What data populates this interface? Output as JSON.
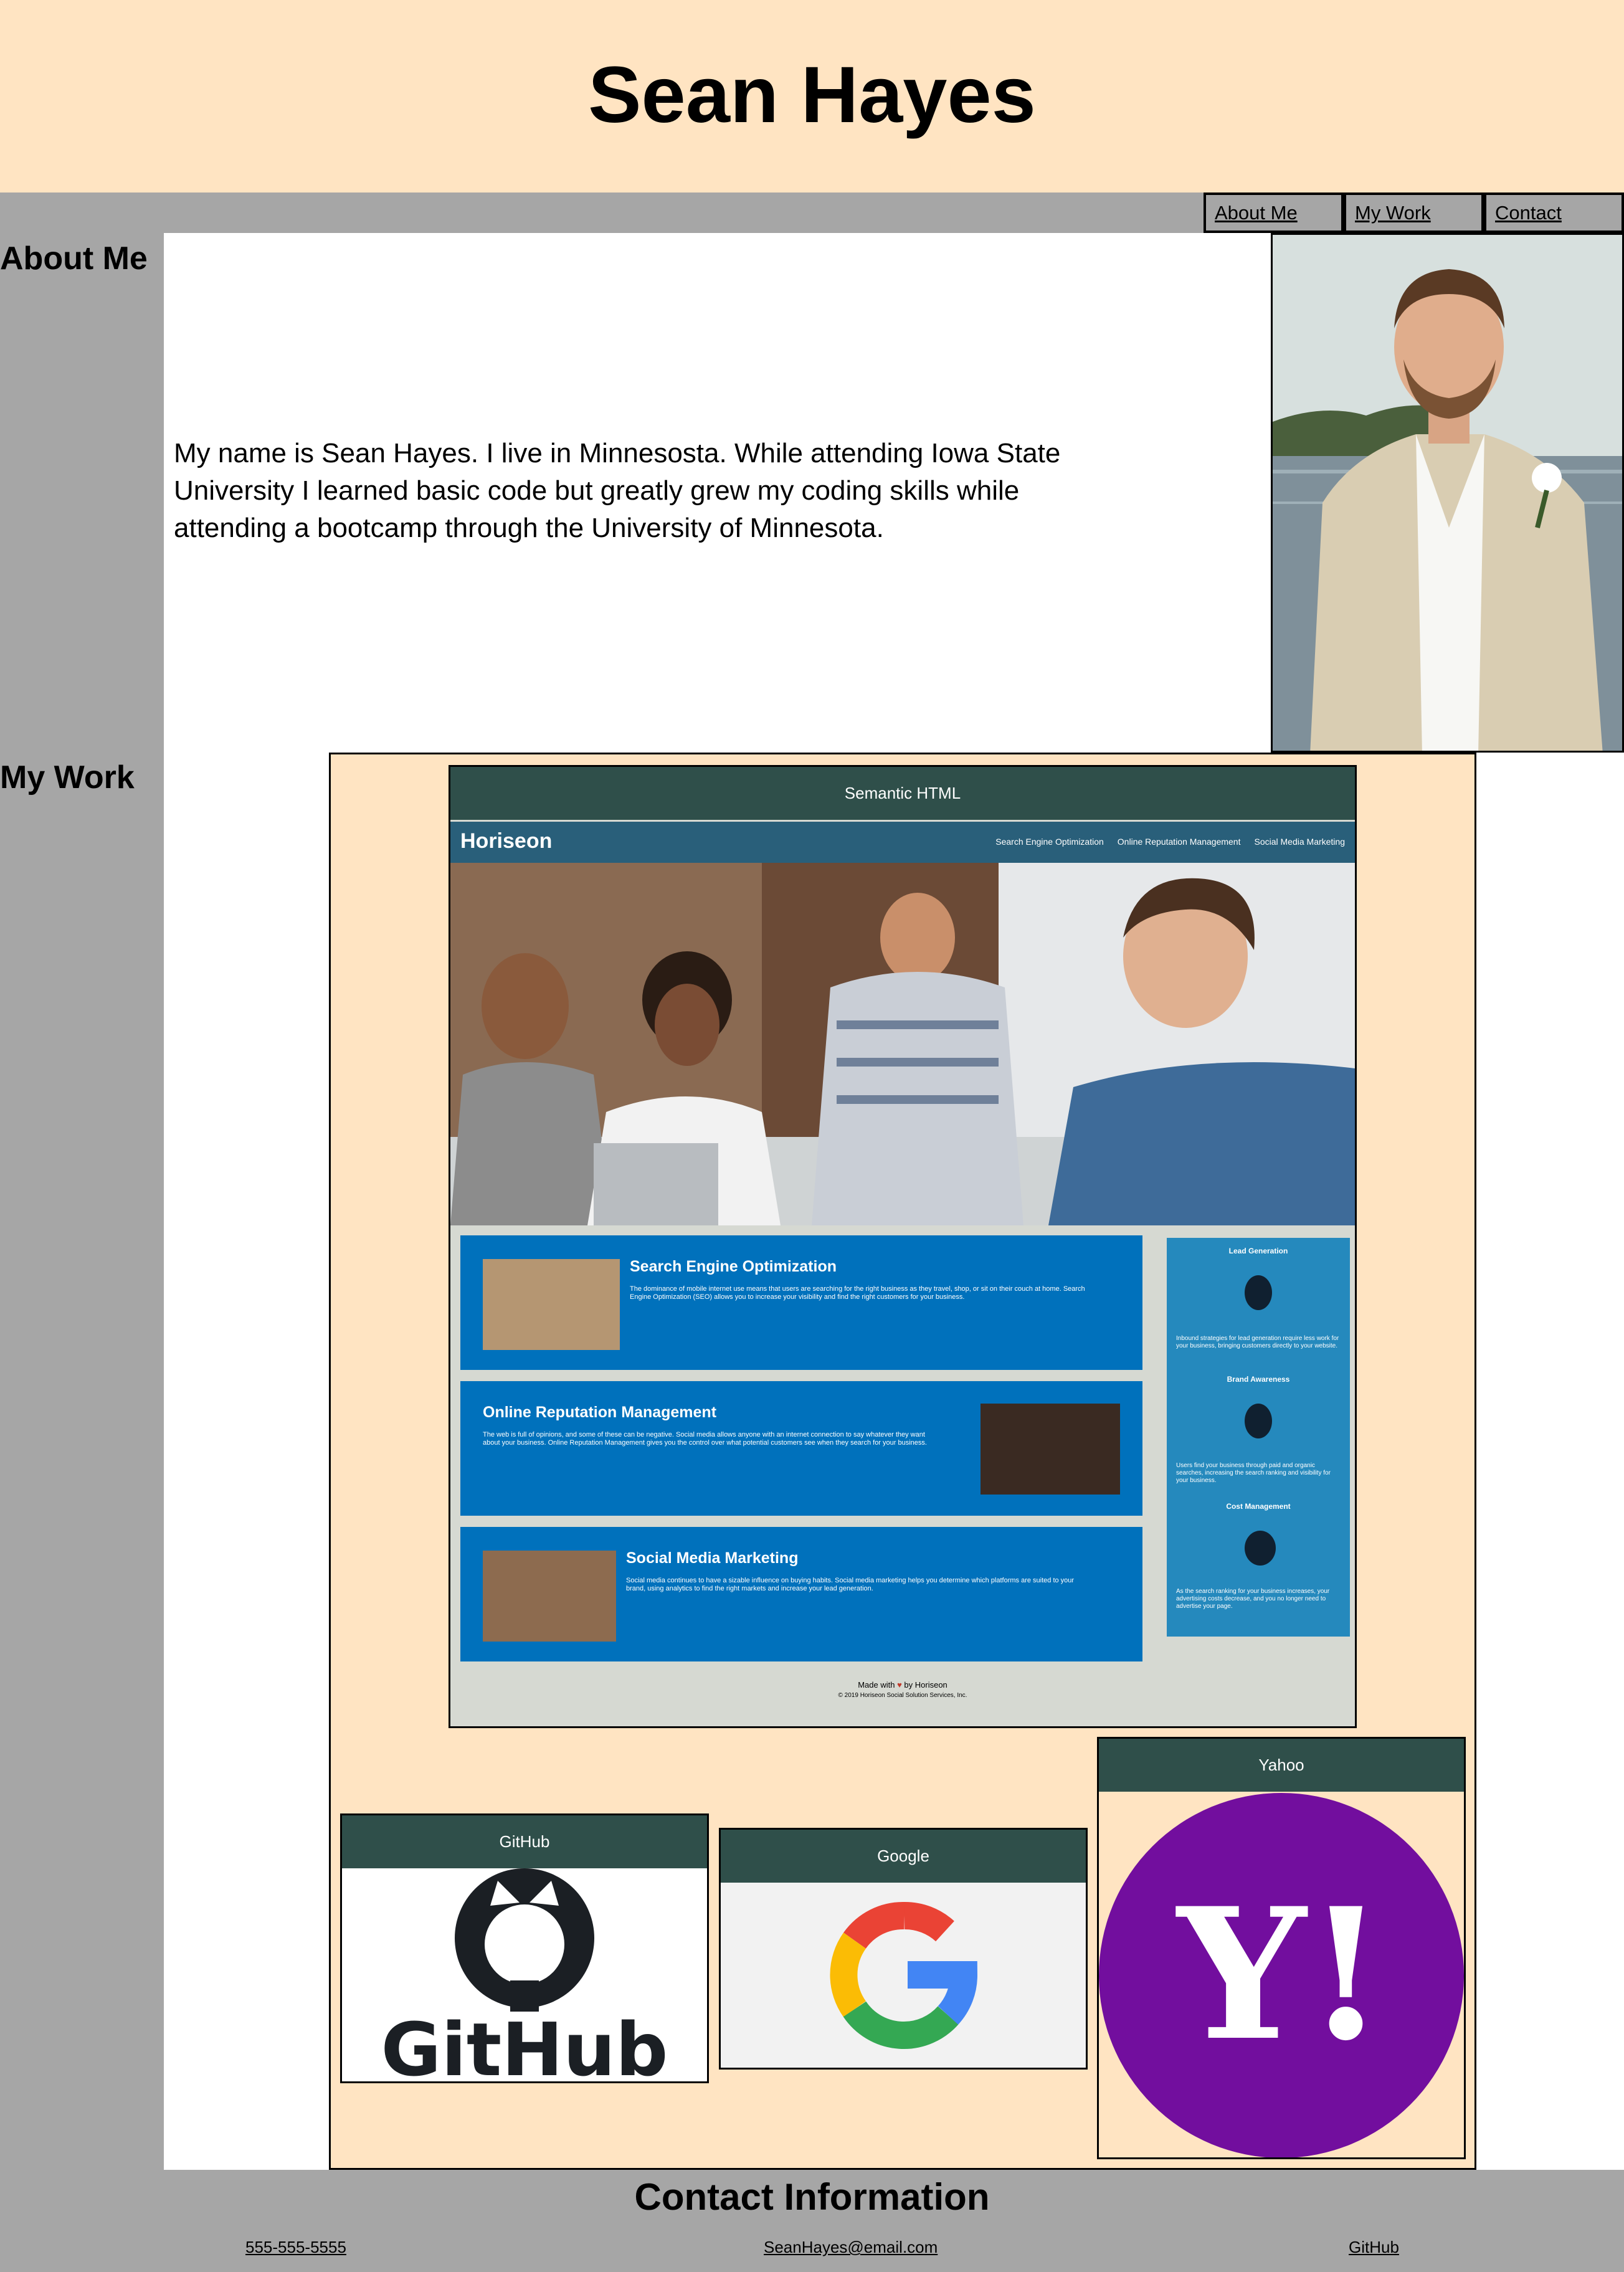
{
  "header": {
    "title": "Sean Hayes"
  },
  "nav": {
    "items": [
      "About Me",
      "My Work",
      "Contact"
    ]
  },
  "about": {
    "heading": "About Me",
    "text": "My name is Sean Hayes. I live in Minnesosta. While attending Iowa State University I learned basic code but greatly grew my coding skills while attending a bootcamp through the University of Minnesota."
  },
  "work": {
    "heading": "My Work",
    "featured": {
      "title": "Semantic HTML",
      "mock": {
        "logo": "Horiseon",
        "links": [
          "Search Engine Optimization",
          "Online Reputation Management",
          "Social Media Marketing"
        ],
        "sections": [
          {
            "title": "Search Engine Optimization",
            "text": "The dominance of mobile internet use means that users are searching for the right business as they travel, shop, or sit on their couch at home. Search Engine Optimization (SEO) allows you to increase your visibility and find the right customers for your business."
          },
          {
            "title": "Online Reputation Management",
            "text": "The web is full of opinions, and some of these can be negative. Social media allows anyone with an internet connection to say whatever they want about your business. Online Reputation Management gives you the control over what potential customers see when they search for your business."
          },
          {
            "title": "Social Media Marketing",
            "text": "Social media continues to have a sizable influence on buying habits. Social media marketing helps you determine which platforms are suited to your brand, using analytics to find the right markets and increase your lead generation."
          }
        ],
        "benefits": [
          {
            "title": "Lead Generation",
            "text": "Inbound strategies for lead generation require less work for your business, bringing customers directly to your website."
          },
          {
            "title": "Brand Awareness",
            "text": "Users find your business through paid and organic searches, increasing the search ranking and visibility for your business."
          },
          {
            "title": "Cost Management",
            "text": "As the search ranking for your business increases, your advertising costs decrease, and you no longer need to advertise your page."
          }
        ],
        "footer_made": "Made with",
        "footer_by": "by Horiseon",
        "footer_copy": "© 2019 Horiseon Social Solution Services, Inc."
      }
    },
    "cards": [
      {
        "title": "GitHub",
        "logo_text": "GitHub"
      },
      {
        "title": "Google"
      },
      {
        "title": "Yahoo",
        "logo_text": "Y!"
      }
    ]
  },
  "contact": {
    "heading": "Contact Information",
    "phone": "555-555-5555",
    "email": "SeanHayes@email.com",
    "github": "GitHub"
  },
  "colors": {
    "header_bg": "#ffe4c2",
    "page_bg": "#a6a6a6",
    "card_title_bg": "#2f4f4a",
    "horiseon_nav": "#295f7a",
    "horiseon_box": "#0071bc",
    "yahoo_purple": "#720e9e"
  }
}
